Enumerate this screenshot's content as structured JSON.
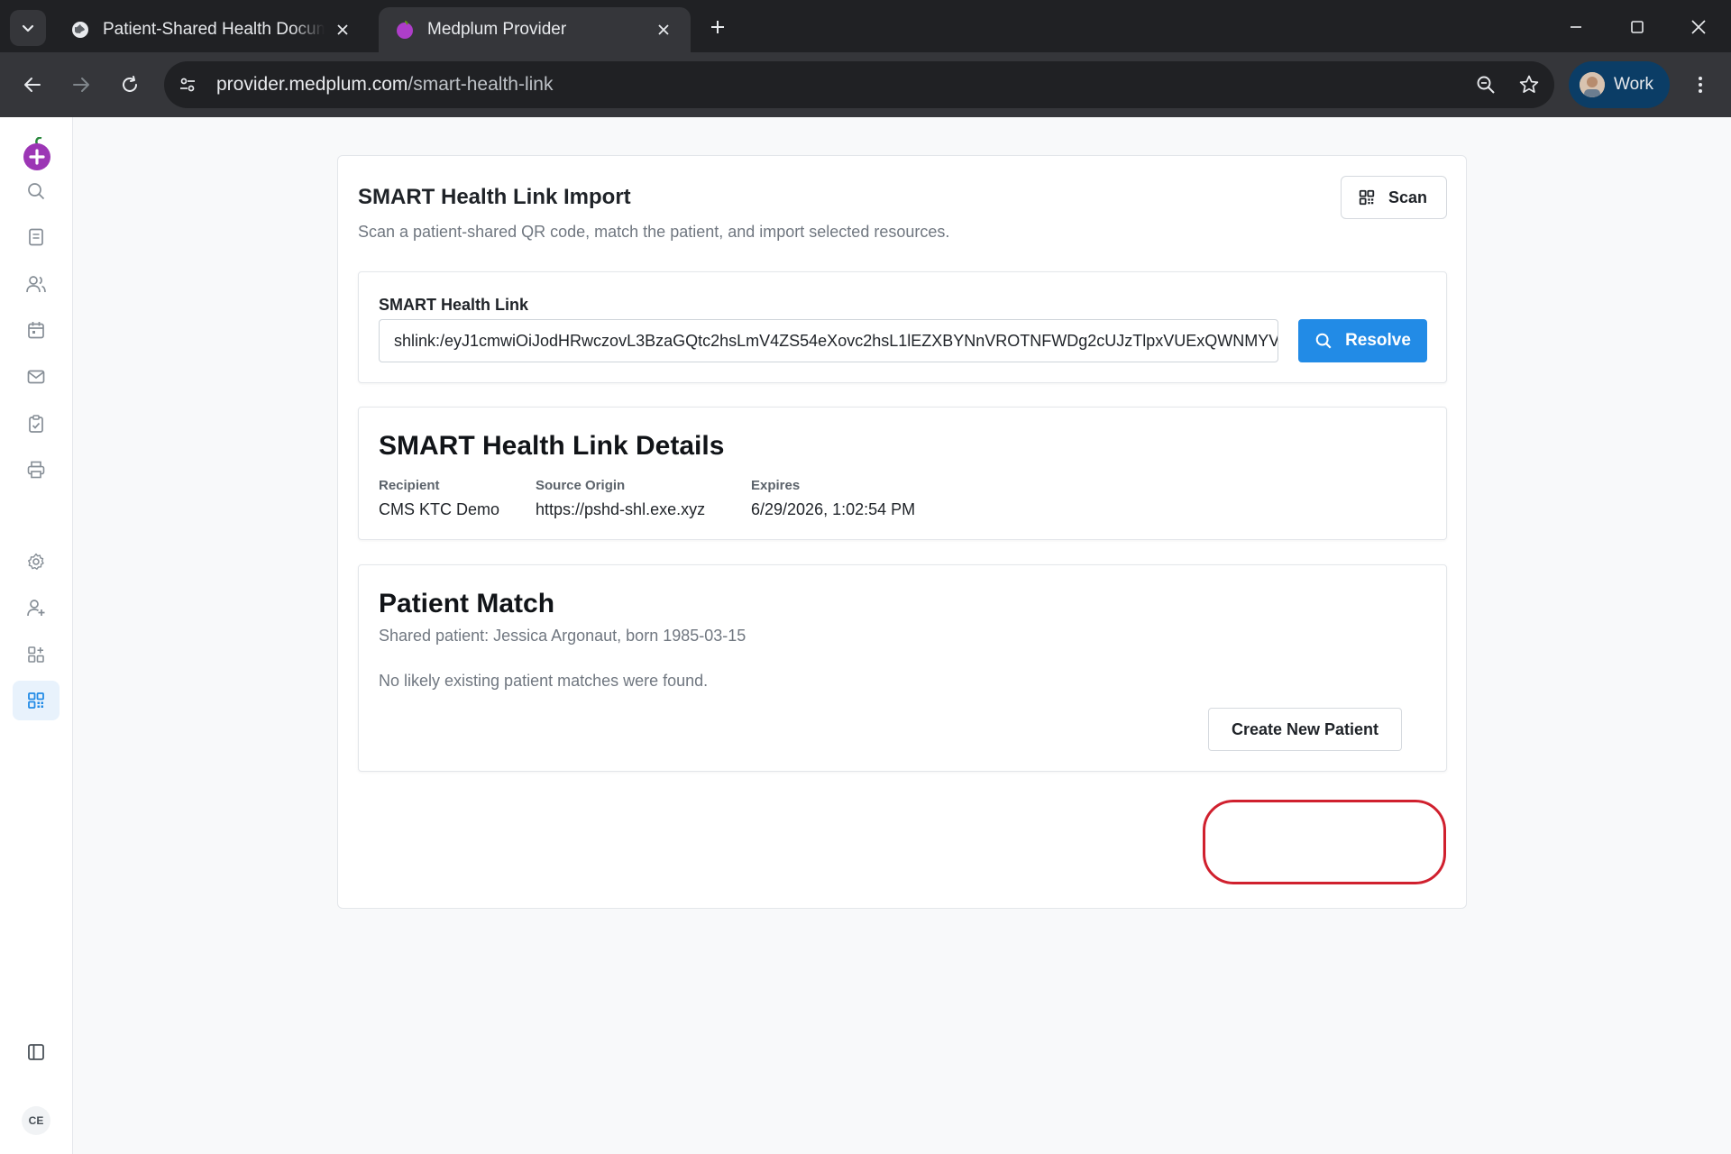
{
  "browser": {
    "tabs": [
      {
        "title": "Patient-Shared Health Documents",
        "icon": "globe-icon",
        "active": false
      },
      {
        "title": "Medplum Provider",
        "icon": "medplum-icon",
        "active": true
      }
    ],
    "url_host": "provider.medplum.com",
    "url_path": "/smart-health-link",
    "profile_label": "Work"
  },
  "sidebar": {
    "items": [
      {
        "icon": "search-icon",
        "active": false
      },
      {
        "icon": "document-icon",
        "active": false
      },
      {
        "icon": "users-icon",
        "active": false
      },
      {
        "icon": "calendar-icon",
        "active": false
      },
      {
        "icon": "mail-icon",
        "active": false
      },
      {
        "icon": "clipboard-check-icon",
        "active": false
      },
      {
        "icon": "printer-icon",
        "active": false
      },
      {
        "icon": "settings-icon",
        "active": false
      },
      {
        "icon": "user-plus-icon",
        "active": false
      },
      {
        "icon": "apps-add-icon",
        "active": false
      },
      {
        "icon": "qr-code-icon",
        "active": true
      }
    ],
    "user_initials": "CE"
  },
  "page": {
    "title": "SMART Health Link Import",
    "subtitle": "Scan a patient-shared QR code, match the patient, and import selected resources.",
    "scan_label": "Scan"
  },
  "link_form": {
    "label": "SMART Health Link",
    "value": "shlink:/eyJ1cmwiOiJodHRwczovL3BzaGQtc2hsLmV4ZS54eXovc2hsL1lEZXBYNnVROTNFWDg2cUJzTlpxVUExQWNMYV",
    "resolve_label": "Resolve"
  },
  "details": {
    "heading": "SMART Health Link Details",
    "fields": [
      {
        "label": "Recipient",
        "value": "CMS KTC Demo"
      },
      {
        "label": "Source Origin",
        "value": "https://pshd-shl.exe.xyz"
      },
      {
        "label": "Expires",
        "value": "6/29/2026, 1:02:54 PM"
      }
    ]
  },
  "match": {
    "heading": "Patient Match",
    "shared_patient": "Shared patient: Jessica Argonaut, born 1985-03-15",
    "no_match": "No likely existing patient matches were found.",
    "create_label": "Create New Patient"
  },
  "colors": {
    "primary": "#228be6",
    "brand": "#9c36b5",
    "highlight": "#d0202e"
  }
}
